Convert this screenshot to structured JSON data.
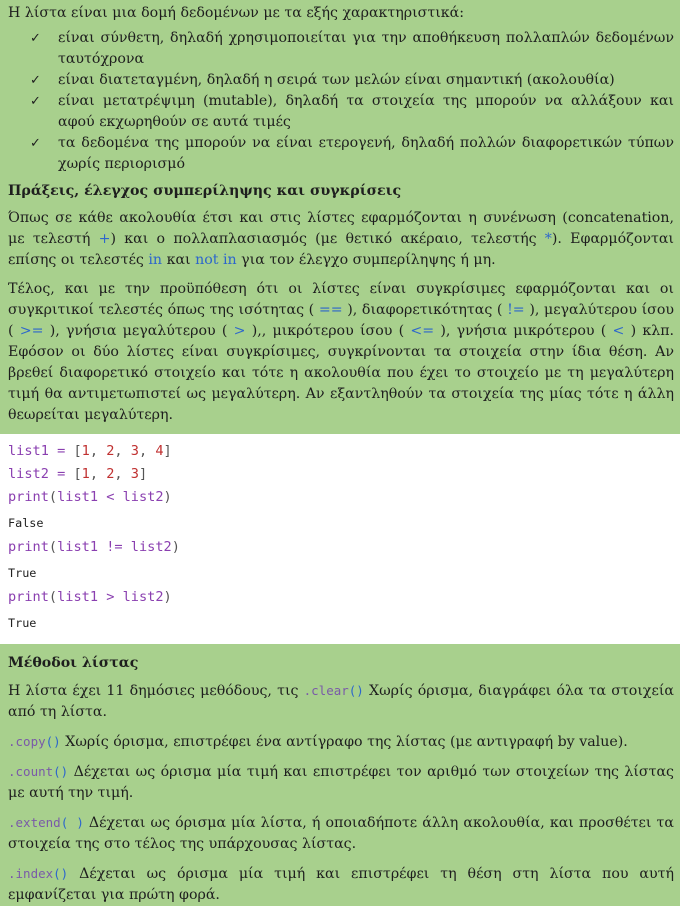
{
  "intro": "Η λίστα είναι μια δομή δεδομένων με τα εξής χαρακτηριστικά:",
  "features": [
    "είναι σύνθετη, δηλαδή χρησιμοποιείται για την αποθήκευση πολλαπλών δεδομένων ταυτόχρονα",
    "είναι διατεταγμένη, δηλαδή η σειρά των μελών είναι σημαντική (ακολουθία)",
    "είναι μετατρέψιμη (mutable), δηλαδή τα στοιχεία της μπορούν να αλλάξουν και αφού εκχωρηθούν σε αυτά τιμές",
    "τα δεδομένα της μπορούν να είναι ετερογενή, δηλαδή πολλών διαφορετικών τύπων χωρίς περιορισμό"
  ],
  "check_glyph": "✓",
  "section1_title": "Πράξεις, έλεγχος συμπερίληψης και συγκρίσεις",
  "p1": {
    "a": "Όπως σε κάθε ακολουθία έτσι και στις λίστες εφαρμόζονται η συνένωση (concatenation, με τελεστή ",
    "op1": "+",
    "b": ") και ο πολλαπλασιασμός (με θετικό ακέραιο, τελεστής ",
    "op2": "*",
    "c": "). Εφαρμόζονται επίσης οι τελεστές ",
    "op3": "in",
    "d": " και ",
    "op4": "not in",
    "e": " για τον έλεγχο συμπερίληψης ή μη."
  },
  "p2": {
    "a": "Τέλος, και με την προϋπόθεση ότι οι λίστες είναι συγκρίσιμες εφαρμόζονται και οι συγκριτικοί τελεστές όπως της ισότητας ( ",
    "op1": "==",
    "b": " ), διαφορετικότητας ( ",
    "op2": "!=",
    "c": " ), μεγαλύτερου ίσου ( ",
    "op3": ">=",
    "d": " ), γνήσια μεγαλύτερου ( ",
    "op4": ">",
    "e": " ),, μικρότερου ίσου ( ",
    "op5": "<=",
    "f": " ), γνήσια μικρότερου ( ",
    "op6": "<",
    "g": " ) κλπ. Εφόσον οι δύο λίστες είναι συγκρίσιμες, συγκρίνονται τα στοιχεία στην ίδια θέση. Αν βρεθεί διαφορετικό στοιχείο και τότε η ακολουθία που έχει το στοιχείο με τη μεγαλύτερη τιμή θα αντιμετωπιστεί ως μεγαλύτερη. Αν εξαντληθούν τα στοιχεία της μίας τότε η άλλη θεωρείται μεγαλύτερη."
  },
  "code": {
    "l1_var": "list1",
    "l1_eq": " = ",
    "l1_vals": [
      "1",
      "2",
      "3",
      "4"
    ],
    "l2_var": "list2",
    "l2_eq": " = ",
    "l2_vals": [
      "1",
      "2",
      "3"
    ],
    "print_fn": "print",
    "cmp1": "list1 < list2",
    "out1": "False",
    "cmp2": "list1 != list2",
    "out2": "True",
    "cmp3": "list1 > list2",
    "out3": "True"
  },
  "section2_title": "Μέθοδοι λίστας",
  "methods_intro": {
    "a": "Η λίστα έχει 11 δημόσιες μεθόδους, τις ",
    "name": ".clear",
    "parens": "()",
    "b": " Χωρίς όρισμα, διαγράφει όλα τα στοιχεία από τη λίστα."
  },
  "methods": [
    {
      "name": ".copy",
      "parens": "()",
      "desc": " Χωρίς όρισμα, επιστρέφει ένα αντίγραφο της λίστας (με αντιγραφή by value)."
    },
    {
      "name": ".count",
      "parens": "()",
      "desc": " Δέχεται ως όρισμα μία τιμή και επιστρέφει τον αριθμό των στοιχείων της λίστας με αυτή την τιμή."
    },
    {
      "name": ".extend",
      "parens": "( )",
      "desc": " Δέχεται ως όρισμα μία λίστα, ή οποιαδήποτε άλλη ακολουθία, και προσθέτει τα στοιχεία της στο τέλος της υπάρχουσας λίστας."
    },
    {
      "name": ".index",
      "parens": "()",
      "desc": " Δέχεται ως όρισμα μία τιμή και επιστρέφει τη θέση στη λίστα που αυτή εμφανίζεται για πρώτη φορά."
    }
  ]
}
